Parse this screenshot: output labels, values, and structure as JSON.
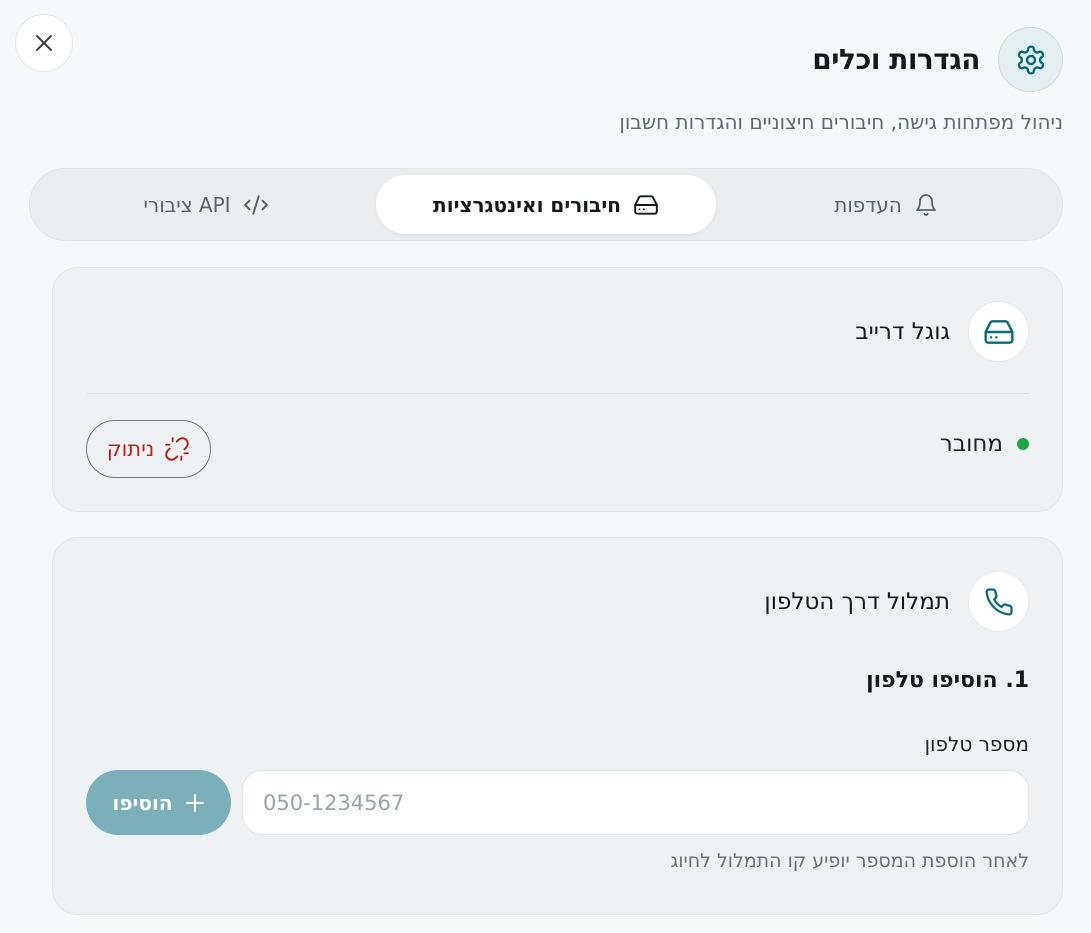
{
  "header": {
    "title": "הגדרות וכלים",
    "subtitle": "ניהול מפתחות גישה, חיבורים חיצוניים והגדרות חשבון",
    "icon": "gear-icon"
  },
  "close": {
    "icon": "close-icon"
  },
  "tabs": [
    {
      "label": "העדפות",
      "icon": "bell-icon",
      "active": false
    },
    {
      "label": "חיבורים ואינטגרציות",
      "icon": "hard-drive-icon",
      "active": true
    },
    {
      "label": "API ציבורי",
      "icon": "code-icon",
      "active": false
    }
  ],
  "google_drive": {
    "title": "גוגל דרייב",
    "icon": "hard-drive-icon",
    "status": "מחובר",
    "status_color": "#1fa34a",
    "disconnect_label": "ניתוק",
    "disconnect_color": "#b3261e"
  },
  "phone": {
    "title": "תמלול דרך הטלפון",
    "icon": "phone-icon",
    "step_title": "1. הוסיפו טלפון",
    "field_label": "מספר טלפון",
    "input_value": "",
    "input_placeholder": "050-1234567",
    "add_label": "הוסיפו",
    "hint": "לאחר הוספת המספר יופיע קו התמלול לחיוג"
  },
  "colors": {
    "accent": "#0e6a76",
    "add_button": "#7bafb9",
    "background": "#f6f9fa"
  }
}
